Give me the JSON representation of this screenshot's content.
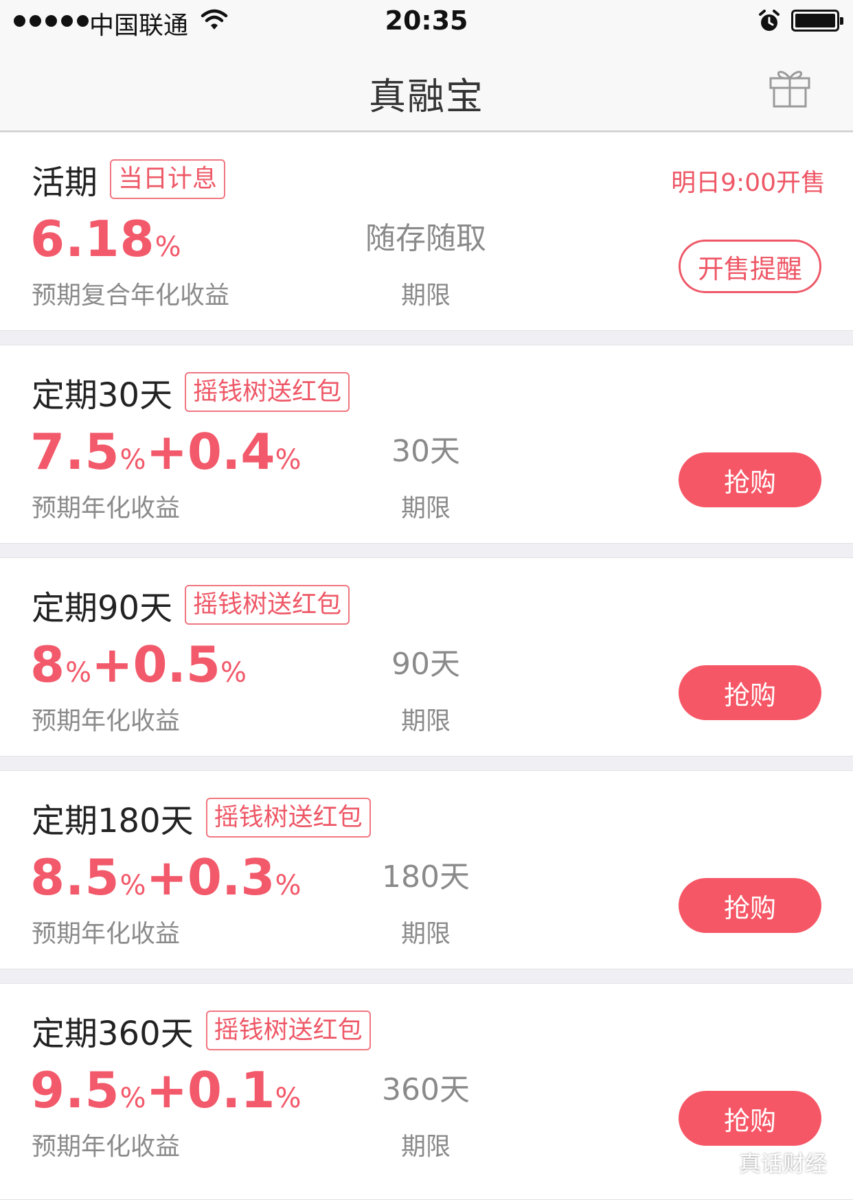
{
  "status_bar": {
    "carrier": "中国联通",
    "time": "20:35"
  },
  "header": {
    "title": "真融宝",
    "gift_icon": "gift-icon"
  },
  "colors": {
    "accent": "#f2596a",
    "button": "#f65766",
    "muted_text": "#8a8a8a",
    "divider": "#efeff4"
  },
  "products": [
    {
      "name": "活期",
      "tag": "当日计息",
      "rate_main": "6.18",
      "rate_pct": "%",
      "rate_plus": "",
      "rate_bonus_pct": "",
      "rate_label": "预期复合年化收益",
      "term": "随存随取",
      "term_label": "期限",
      "sale_time": "明日9:00开售",
      "action": "开售提醒"
    },
    {
      "name": "定期30天",
      "tag": "摇钱树送红包",
      "rate_main": "7.5",
      "rate_pct": "%",
      "rate_plus": "+0.4",
      "rate_bonus_pct": "%",
      "rate_label": "预期年化收益",
      "term": "30天",
      "term_label": "期限",
      "action": "抢购"
    },
    {
      "name": "定期90天",
      "tag": "摇钱树送红包",
      "rate_main": "8",
      "rate_pct": "%",
      "rate_plus": "+0.5",
      "rate_bonus_pct": "%",
      "rate_label": "预期年化收益",
      "term": "90天",
      "term_label": "期限",
      "action": "抢购"
    },
    {
      "name": "定期180天",
      "tag": "摇钱树送红包",
      "rate_main": "8.5",
      "rate_pct": "%",
      "rate_plus": "+0.3",
      "rate_bonus_pct": "%",
      "rate_label": "预期年化收益",
      "term": "180天",
      "term_label": "期限",
      "action": "抢购"
    },
    {
      "name": "定期360天",
      "tag": "摇钱树送红包",
      "rate_main": "9.5",
      "rate_pct": "%",
      "rate_plus": "+0.1",
      "rate_bonus_pct": "%",
      "rate_label": "预期年化收益",
      "term": "360天",
      "term_label": "期限",
      "action": "抢购"
    }
  ],
  "watermark": "真话财经"
}
